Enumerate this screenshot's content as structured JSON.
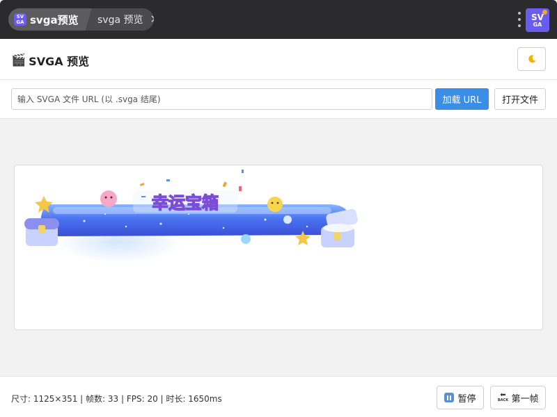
{
  "tabbar": {
    "active_tab_label": "svga预览",
    "app_icon_text_top": "SV",
    "app_icon_text_bottom": "GA",
    "second_tab_label": "svga 预览",
    "close_glyph": "✕",
    "brand_text_top": "SV",
    "brand_text_bottom": "GA"
  },
  "header": {
    "title": "SVGA 预览",
    "title_icon": "clapperboard-icon",
    "theme_icon": "moon-icon"
  },
  "urlbar": {
    "placeholder": "输入 SVGA 文件 URL (以 .svga 结尾)",
    "value": "",
    "load_label": "加载 URL",
    "open_label": "打开文件"
  },
  "preview": {
    "banner_text": "幸运宝箱"
  },
  "footer": {
    "info": "尺寸: 1125×351 | 帧数: 33 | FPS: 20 | 时长: 1650ms",
    "pause_label": "暂停",
    "first_frame_label": "第一帧",
    "back_icon_text": "BACK"
  },
  "colors": {
    "tabbar_bg": "#2b2b2d",
    "accent": "#3a8ee6",
    "brand": "#6b5cf0"
  }
}
